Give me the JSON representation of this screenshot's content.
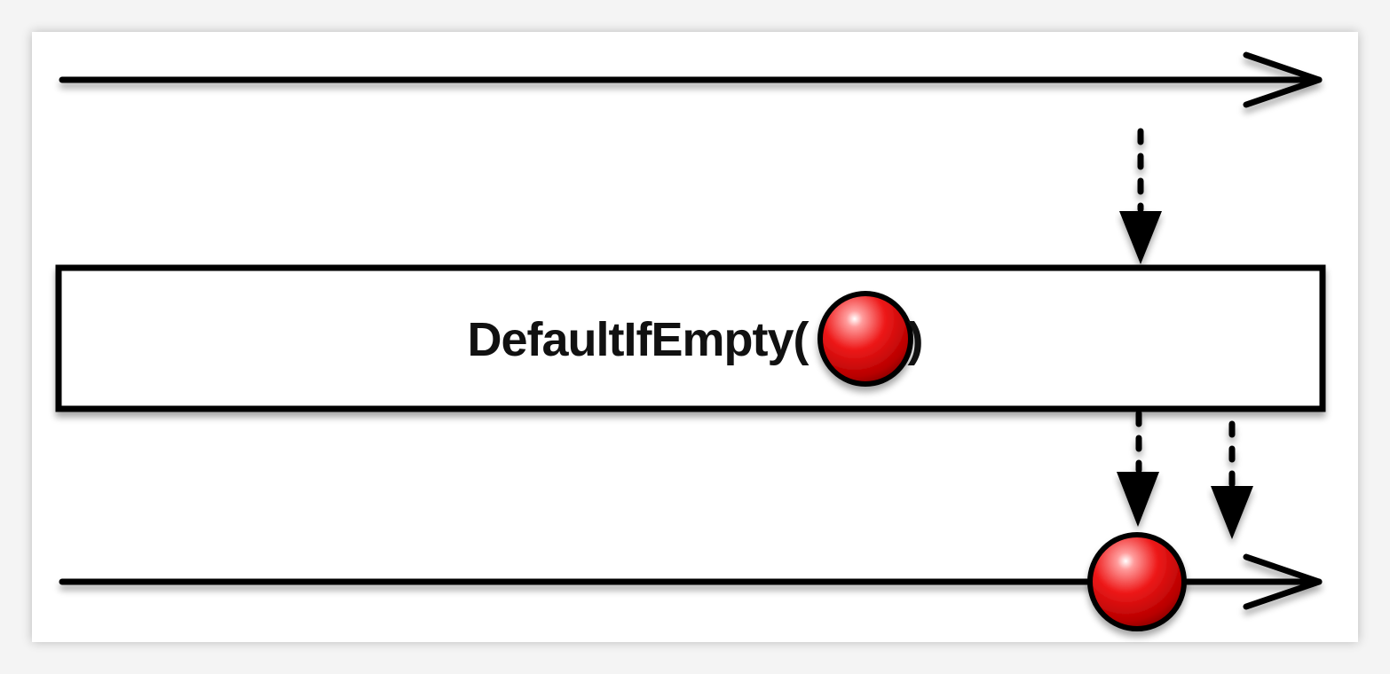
{
  "operator": {
    "name": "DefaultIfEmpty",
    "open_paren": "(",
    "close_paren": ")",
    "argument": "red-marble"
  },
  "marble_color": "#e01212",
  "timelines": {
    "source": {
      "events": [
        "completion"
      ]
    },
    "result": {
      "events": [
        "red-marble",
        "completion"
      ]
    }
  }
}
